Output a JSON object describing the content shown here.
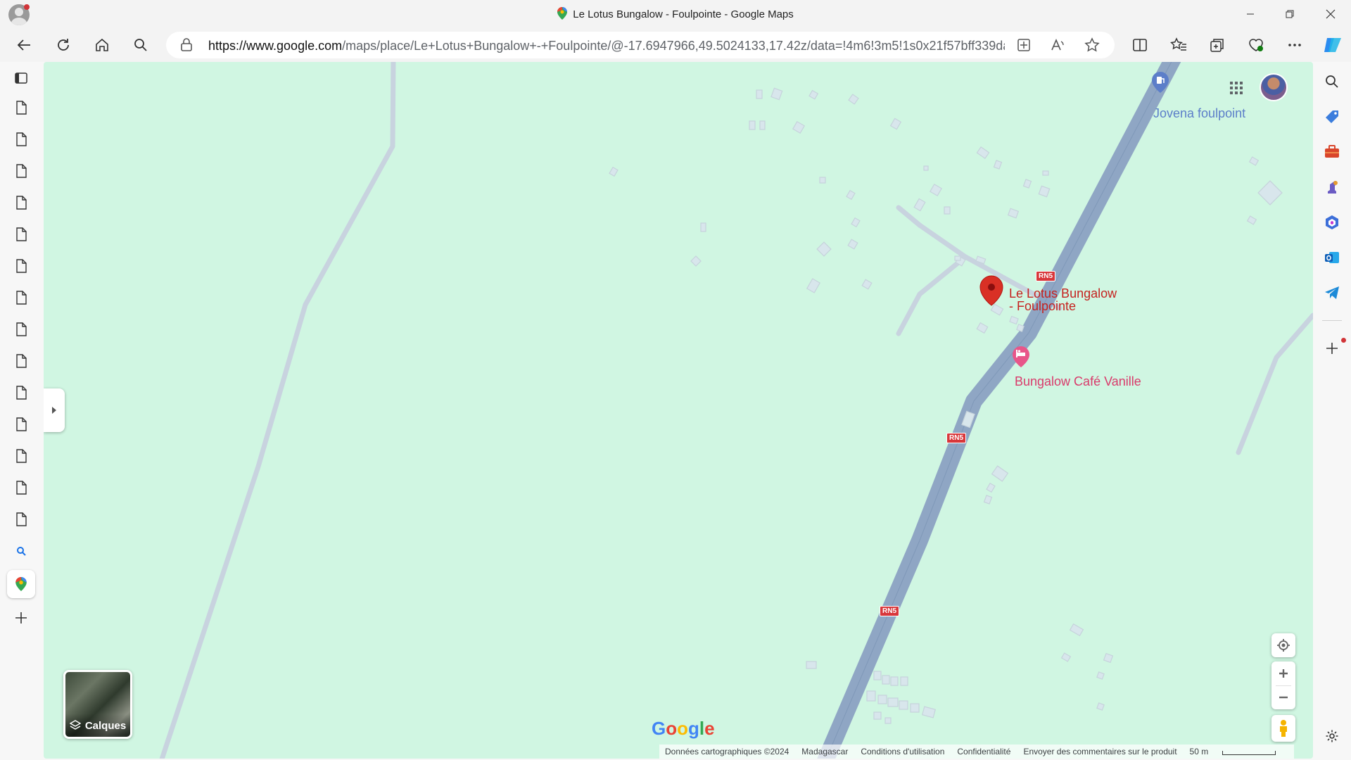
{
  "window": {
    "title": "Le Lotus Bungalow - Foulpointe - Google Maps"
  },
  "toolbar": {
    "url_host": "https://www.google.com",
    "url_rest": "/maps/place/Le+Lotus+Bungalow+-+Foulpointe/@-17.6947966,49.5024133,17.42z/data=!4m6!3m5!1s0x21f57bff339da..."
  },
  "map": {
    "pois": {
      "jovena": "Jovena foulpoint",
      "lotus_line1": "Le Lotus Bungalow",
      "lotus_line2": "- Foulpointe",
      "vanille": "Bungalow Café Vanille"
    },
    "road_shields": [
      "RN5",
      "RN5",
      "RN5"
    ],
    "layers_label": "Calques",
    "google_logo": "Google",
    "footer": {
      "data": "Données cartographiques ©2024",
      "country": "Madagascar",
      "terms": "Conditions d'utilisation",
      "privacy": "Confidentialité",
      "feedback": "Envoyer des commentaires sur le produit",
      "scale": "50 m"
    }
  },
  "colors": {
    "map_bg": "#d0f6e2",
    "highway": "#8fa6c4",
    "minor_road": "#c8d3df",
    "marker_red": "#d93025",
    "poi_pink": "#e8568a",
    "poi_blue": "#5c7ec9"
  }
}
